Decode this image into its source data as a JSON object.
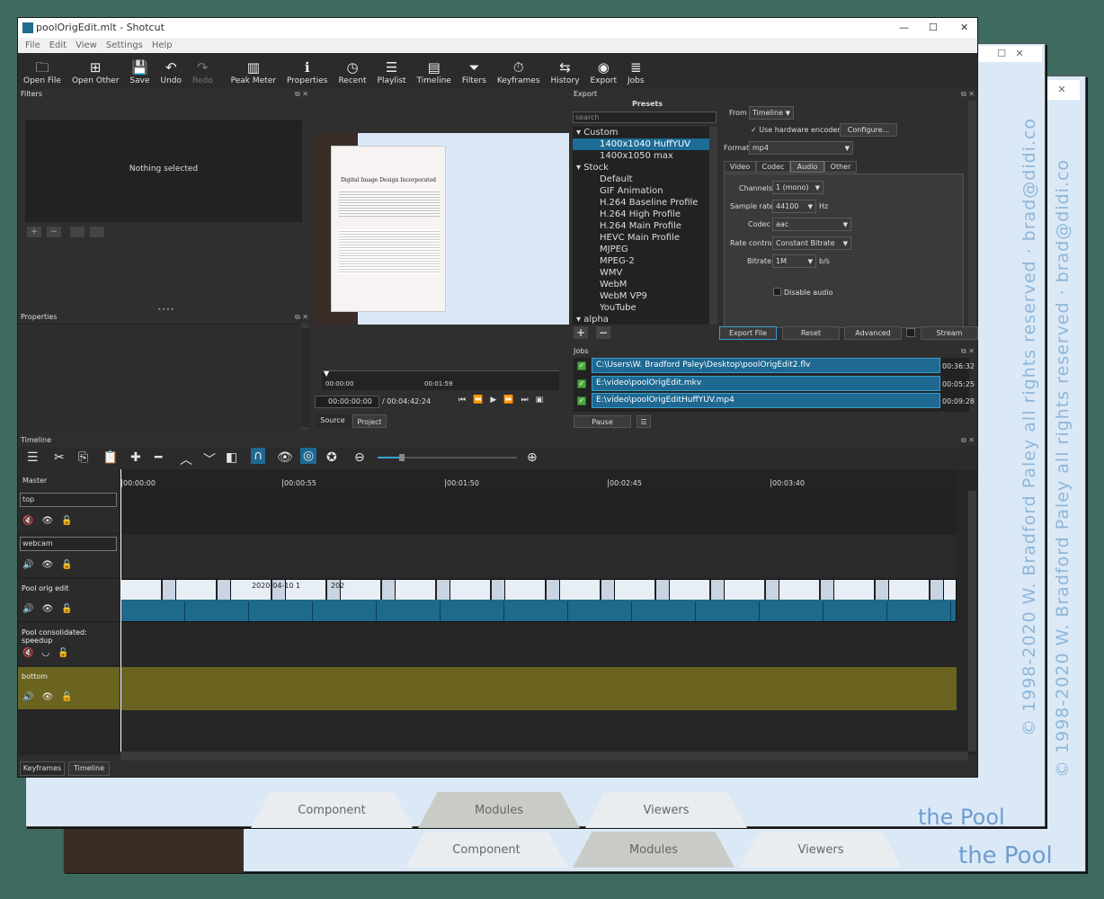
{
  "window": {
    "title": "poolOrigEdit.mlt - Shotcut",
    "controls": [
      "—",
      "☐",
      "✕"
    ]
  },
  "menu": [
    "File",
    "Edit",
    "View",
    "Settings",
    "Help"
  ],
  "toolbar": [
    {
      "label": "Open File",
      "icon": "folder-open-icon",
      "glyph": "🗀"
    },
    {
      "label": "Open Other",
      "icon": "open-other-icon",
      "glyph": "⊞"
    },
    {
      "label": "Save",
      "icon": "save-icon",
      "glyph": "💾"
    },
    {
      "label": "Undo",
      "icon": "undo-icon",
      "glyph": "↶"
    },
    {
      "label": "Redo",
      "icon": "redo-icon",
      "glyph": "↷"
    },
    {
      "label": "Peak Meter",
      "icon": "peak-meter-icon",
      "glyph": "▥"
    },
    {
      "label": "Properties",
      "icon": "info-icon",
      "glyph": "ℹ"
    },
    {
      "label": "Recent",
      "icon": "clock-icon",
      "glyph": "◷"
    },
    {
      "label": "Playlist",
      "icon": "playlist-icon",
      "glyph": "☰"
    },
    {
      "label": "Timeline",
      "icon": "timeline-icon",
      "glyph": "▤"
    },
    {
      "label": "Filters",
      "icon": "funnel-icon",
      "glyph": "⏷"
    },
    {
      "label": "Keyframes",
      "icon": "stopwatch-icon",
      "glyph": "⏱"
    },
    {
      "label": "History",
      "icon": "history-icon",
      "glyph": "⇆"
    },
    {
      "label": "Export",
      "icon": "export-icon",
      "glyph": "◉"
    },
    {
      "label": "Jobs",
      "icon": "jobs-icon",
      "glyph": "≣"
    }
  ],
  "filters": {
    "title": "Filters",
    "empty": "Nothing selected"
  },
  "properties": {
    "title": "Properties"
  },
  "player": {
    "doc_title": "Digital Image Design Incorporated",
    "ruler_marks": [
      "00:00:00",
      "00:01:59"
    ],
    "current_time": "00:00:00:00",
    "total_time": "/ 00:04:42:24",
    "tabs": [
      "Source",
      "Project"
    ]
  },
  "export": {
    "title": "Export",
    "presets_title": "Presets",
    "search_placeholder": "search",
    "presets": [
      {
        "label": "Custom",
        "type": "group"
      },
      {
        "label": "1400x1040 HuffYUV",
        "type": "item",
        "selected": true
      },
      {
        "label": "1400x1050 max",
        "type": "item"
      },
      {
        "label": "Stock",
        "type": "group"
      },
      {
        "label": "Default",
        "type": "item"
      },
      {
        "label": "GIF Animation",
        "type": "item"
      },
      {
        "label": "H.264 Baseline Profile",
        "type": "item"
      },
      {
        "label": "H.264 High Profile",
        "type": "item"
      },
      {
        "label": "H.264 Main Profile",
        "type": "item"
      },
      {
        "label": "HEVC Main Profile",
        "type": "item"
      },
      {
        "label": "MJPEG",
        "type": "item"
      },
      {
        "label": "MPEG-2",
        "type": "item"
      },
      {
        "label": "WMV",
        "type": "item"
      },
      {
        "label": "WebM",
        "type": "item"
      },
      {
        "label": "WebM VP9",
        "type": "item"
      },
      {
        "label": "YouTube",
        "type": "item"
      },
      {
        "label": "alpha",
        "type": "group"
      }
    ],
    "from_label": "From",
    "from_value": "Timeline",
    "hw_encoder_label": "Use hardware encoder",
    "configure_label": "Configure...",
    "format_label": "Format",
    "format_value": "mp4",
    "tabs": [
      "Video",
      "Codec",
      "Audio",
      "Other"
    ],
    "active_tab": "Audio",
    "channels_label": "Channels",
    "channels_value": "1 (mono)",
    "sample_rate_label": "Sample rate",
    "sample_rate_value": "44100",
    "sample_rate_unit": "Hz",
    "codec_label": "Codec",
    "codec_value": "aac",
    "rate_control_label": "Rate control",
    "rate_control_value": "Constant Bitrate",
    "bitrate_label": "Bitrate",
    "bitrate_value": "1M",
    "bitrate_unit": "b/s",
    "disable_audio_label": "Disable audio",
    "buttons": {
      "export": "Export File",
      "reset": "Reset",
      "advanced": "Advanced",
      "stream": "Stream"
    }
  },
  "jobs": {
    "title": "Jobs",
    "items": [
      {
        "path": "C:\\Users\\W. Bradford Paley\\Desktop\\poolOrigEdit2.flv",
        "time": "00:36:32"
      },
      {
        "path": "E:\\video\\poolOrigEdit.mkv",
        "time": "00:05:25"
      },
      {
        "path": "E:\\video\\poolOrigEditHuffYUV.mp4",
        "time": "00:09:28"
      }
    ],
    "pause_label": "Pause"
  },
  "timeline": {
    "title": "Timeline",
    "ruler": [
      "00:00:00",
      "00:00:55",
      "00:01:50",
      "00:02:45",
      "00:03:40"
    ],
    "master_label": "Master",
    "tracks": [
      {
        "name": "top",
        "editable": true
      },
      {
        "name": "webcam",
        "editable": true
      },
      {
        "name": "Pool orig edit",
        "editable": false
      },
      {
        "name": "Pool consolidated: speedup",
        "editable": false
      },
      {
        "name": "bottom",
        "editable": false
      }
    ],
    "clip_date": "2020-04-10 1",
    "clip_date2": "202",
    "highlight_color": "#6b6420",
    "clip_color": "#1d6a8b"
  },
  "bottom_tabs": [
    "Keyframes",
    "Timeline"
  ],
  "background": {
    "tabs": [
      "Component",
      "Modules",
      "Viewers"
    ],
    "brand": "the Pool",
    "copyright": "© 1998-2020  W. Bradford Paley  all rights reserved  ·  brad@didi.co"
  }
}
